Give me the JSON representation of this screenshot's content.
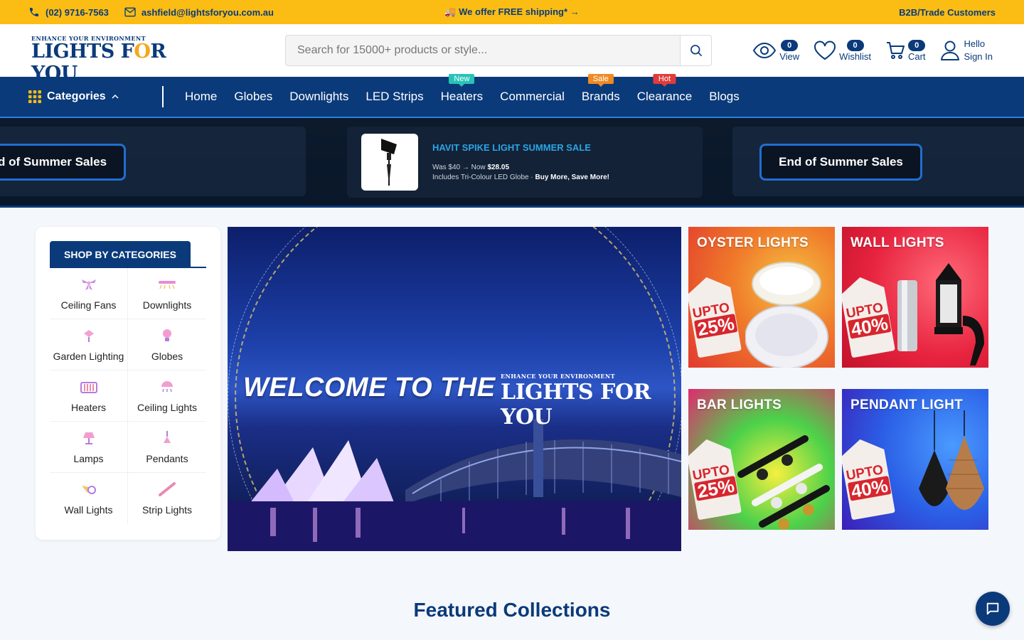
{
  "topbar": {
    "phone": "(02) 9716-7563",
    "email": "ashfield@lightsforyou.com.au",
    "shipping": "🚚 We offer FREE shipping* →",
    "trade": "B2B/Trade Customers"
  },
  "logo": {
    "tagline": "ENHANCE YOUR ENVIRONMENT",
    "name_a": "LIGHTS F",
    "name_o": "O",
    "name_b": "R YOU"
  },
  "search": {
    "placeholder": "Search for 15000+ products or style..."
  },
  "header_icons": {
    "view": {
      "count": "0",
      "label": "View"
    },
    "wishlist": {
      "count": "0",
      "label": "Wishlist"
    },
    "cart": {
      "count": "0",
      "label": "Cart"
    },
    "account": {
      "line1": "Hello",
      "line2": "Sign In"
    }
  },
  "nav": {
    "categories_label": "Categories",
    "links": [
      {
        "label": "Home"
      },
      {
        "label": "Globes"
      },
      {
        "label": "Downlights"
      },
      {
        "label": "LED Strips"
      },
      {
        "label": "Heaters",
        "tag": "New"
      },
      {
        "label": "Commercial"
      },
      {
        "label": "Brands",
        "tag": "Sale"
      },
      {
        "label": "Clearance",
        "tag": "Hot"
      },
      {
        "label": "Blogs"
      }
    ]
  },
  "promo": {
    "left_button": "d of Summer Sales",
    "right_button": "End of Summer Sales",
    "title": "HAVIT SPIKE LIGHT SUMMER SALE",
    "price_line_was": "Was $40 → Now ",
    "price_line_now": "$28.05",
    "include_line": "Includes Tri-Colour LED Globe · ",
    "include_bold": "Buy More, Save More!"
  },
  "shop_by": {
    "heading": "SHOP BY CATEGORIES",
    "items": [
      {
        "label": "Ceiling Fans",
        "icon": "ceiling-fan-icon"
      },
      {
        "label": "Downlights",
        "icon": "downlight-icon"
      },
      {
        "label": "Garden Lighting",
        "icon": "garden-light-icon"
      },
      {
        "label": "Globes",
        "icon": "globe-bulb-icon"
      },
      {
        "label": "Heaters",
        "icon": "heater-icon"
      },
      {
        "label": "Ceiling Lights",
        "icon": "ceiling-light-icon"
      },
      {
        "label": "Lamps",
        "icon": "lamp-icon"
      },
      {
        "label": "Pendants",
        "icon": "pendant-icon"
      },
      {
        "label": "Wall Lights",
        "icon": "wall-light-icon"
      },
      {
        "label": "Strip Lights",
        "icon": "strip-light-icon"
      }
    ]
  },
  "hero": {
    "welcome": "WELCOME TO THE",
    "logo_tagline": "ENHANCE YOUR ENVIRONMENT",
    "logo_name": "LIGHTS FOR YOU"
  },
  "tiles": [
    {
      "title": "OYSTER LIGHTS",
      "upto": "UPTO",
      "pct": "25%"
    },
    {
      "title": "WALL LIGHTS",
      "upto": "UPTO",
      "pct": "40%"
    },
    {
      "title": "BAR LIGHTS",
      "upto": "UPTO",
      "pct": "25%"
    },
    {
      "title": "PENDANT LIGHT",
      "upto": "UPTO",
      "pct": "40%"
    }
  ],
  "featured": {
    "heading": "Featured Collections"
  },
  "colors": {
    "brand_blue": "#0a3a7a",
    "accent_yellow": "#fbbd14",
    "accent_light_blue": "#2aa5e6"
  }
}
